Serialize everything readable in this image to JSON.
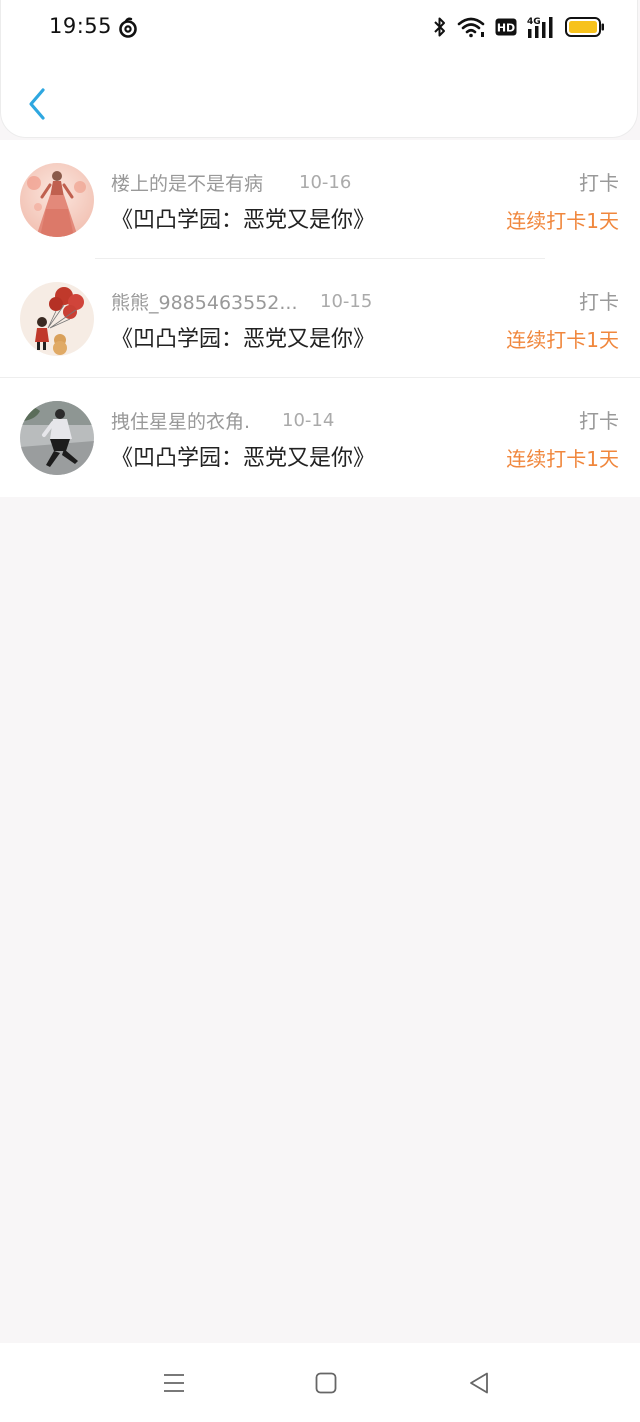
{
  "status_bar": {
    "time": "19:55",
    "icons": [
      "netease-music-icon",
      "bluetooth-icon",
      "wifi-icon",
      "hd-icon",
      "4g-signal-icon",
      "battery-icon"
    ],
    "hd_label": "HD",
    "network_label": "4G"
  },
  "header": {
    "back_icon": "chevron-left-icon",
    "accent_color": "#2ea7e0"
  },
  "records": [
    {
      "username": "楼上的是不是有病",
      "date": "10-16",
      "book": "《凹凸学园：恶党又是你》",
      "action": "打卡",
      "streak": "连续打卡1天"
    },
    {
      "username": "熊熊_9885463552...",
      "date": "10-15",
      "book": "《凹凸学园：恶党又是你》",
      "action": "打卡",
      "streak": "连续打卡1天"
    },
    {
      "username": "拽住星星的衣角.",
      "date": "10-14",
      "book": "《凹凸学园：恶党又是你》",
      "action": "打卡",
      "streak": "连续打卡1天"
    }
  ],
  "colors": {
    "streak": "#f0873d",
    "muted_text": "#999999",
    "primary_text": "#222222",
    "page_background": "#f8f6f7"
  },
  "nav_bar": {
    "buttons": [
      "menu-icon",
      "home-square-icon",
      "back-triangle-icon"
    ]
  }
}
